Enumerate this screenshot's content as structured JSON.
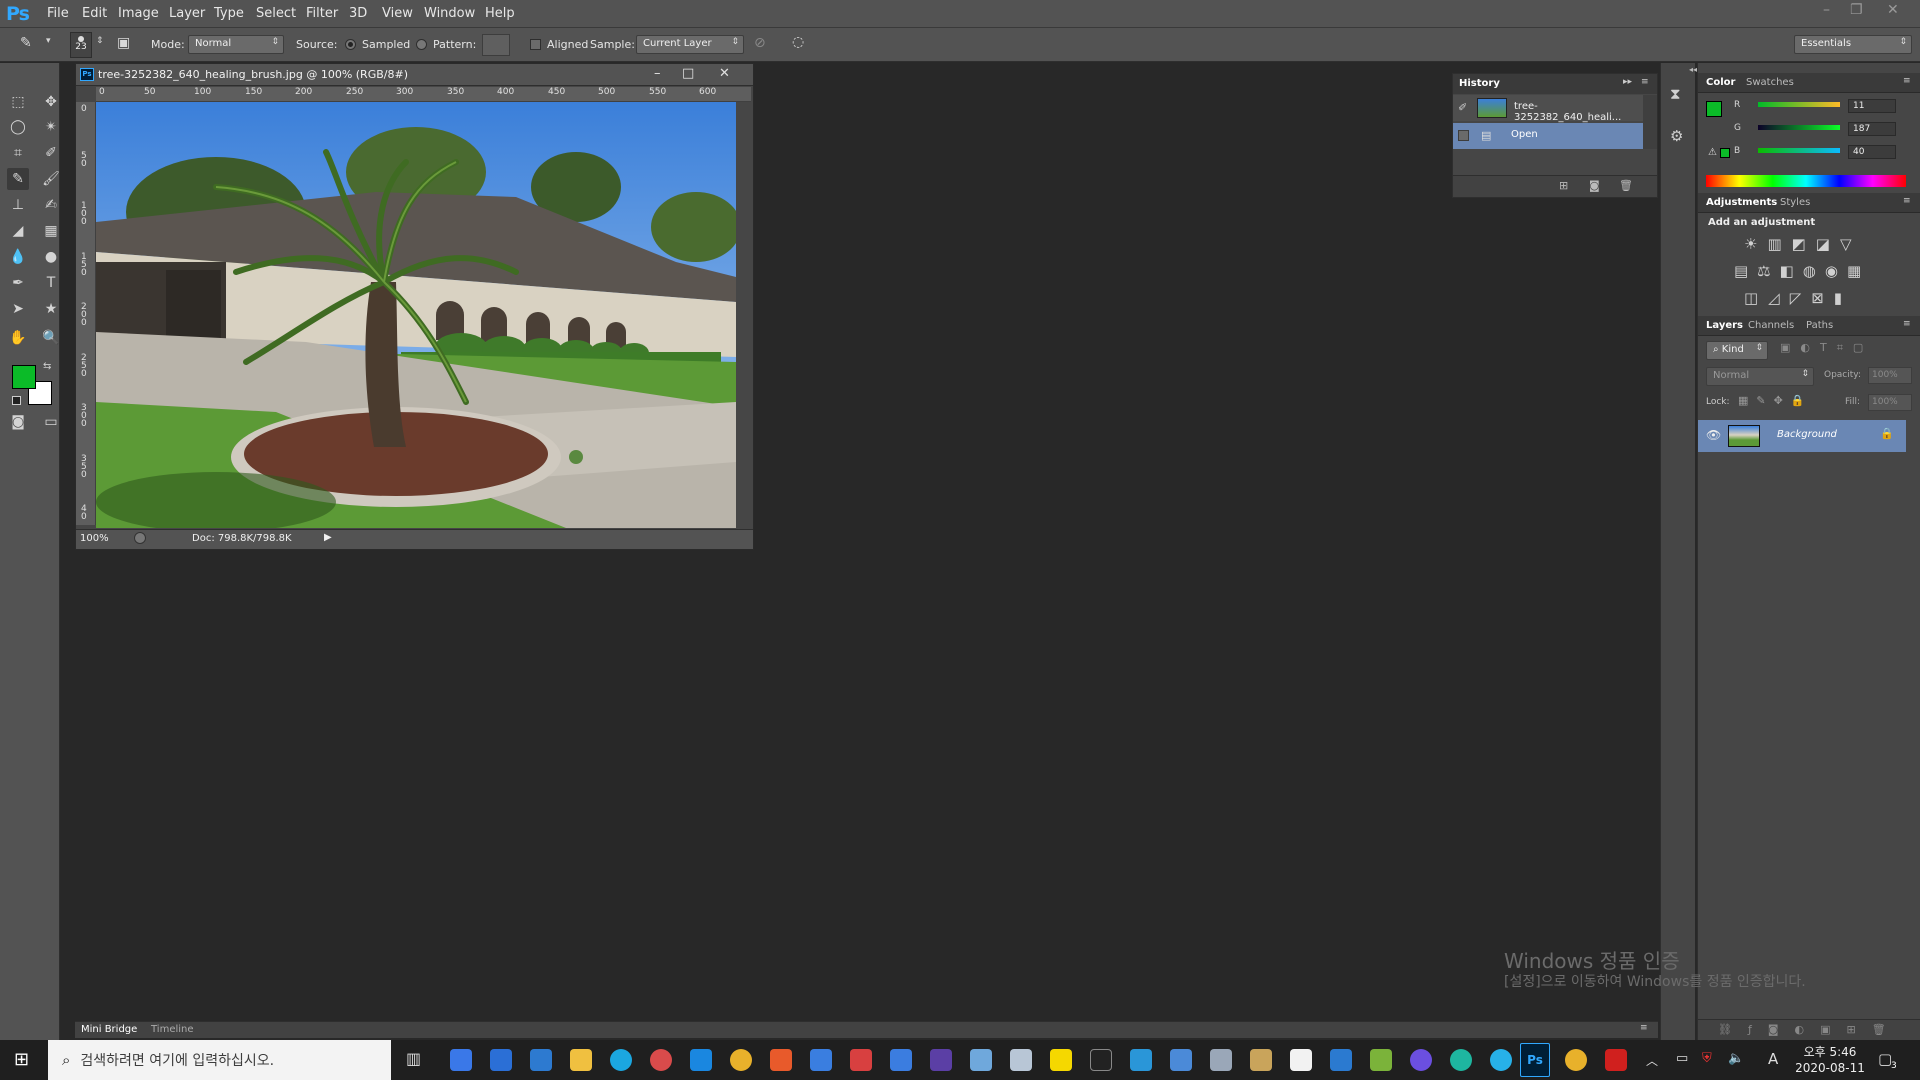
{
  "app": {
    "logo": "Ps",
    "menu": [
      "File",
      "Edit",
      "Image",
      "Layer",
      "Type",
      "Select",
      "Filter",
      "3D",
      "View",
      "Window",
      "Help"
    ]
  },
  "options": {
    "brush_size": "23",
    "mode_label": "Mode:",
    "mode_value": "Normal",
    "source_label": "Source:",
    "sampled_label": "Sampled",
    "pattern_label": "Pattern:",
    "aligned_label": "Aligned",
    "sample_label": "Sample:",
    "sample_value": "Current Layer",
    "workspace": "Essentials"
  },
  "document": {
    "title": "tree-3252382_640_healing_brush.jpg @ 100% (RGB/8#)",
    "ruler_h": [
      "0",
      "50",
      "100",
      "150",
      "200",
      "250",
      "300",
      "350",
      "400",
      "450",
      "500",
      "550",
      "600"
    ],
    "ruler_v": [
      "0",
      "5 0",
      "1 0 0",
      "1 5 0",
      "2 0 0",
      "2 5 0",
      "3 0 0",
      "3 5 0",
      "4 0"
    ],
    "zoom": "100%",
    "doc_size": "Doc: 798.8K/798.8K"
  },
  "history": {
    "tab": "History",
    "snapshot_name": "tree-3252382_640_heali...",
    "step": "Open"
  },
  "color_panel": {
    "tabs": [
      "Color",
      "Swatches"
    ],
    "r_label": "R",
    "g_label": "G",
    "b_label": "B",
    "r": "11",
    "g": "187",
    "b": "40",
    "fg": "#0bbb28"
  },
  "adjustments": {
    "tabs": [
      "Adjustments",
      "Styles"
    ],
    "heading": "Add an adjustment"
  },
  "layers": {
    "tabs": [
      "Layers",
      "Channels",
      "Paths"
    ],
    "kind": "Kind",
    "blend": "Normal",
    "opacity_label": "Opacity:",
    "opacity_value": "100%",
    "lock_label": "Lock:",
    "fill_label": "Fill:",
    "fill_value": "100%",
    "layer_name": "Background"
  },
  "bottom_tabs": [
    "Mini Bridge",
    "Timeline"
  ],
  "watermark": {
    "line1": "Windows 정품 인증",
    "line2": "[설정]으로 이동하여 Windows를 정품 인증합니다."
  },
  "taskbar": {
    "search_placeholder": "검색하려면 여기에 입력하십시오.",
    "time": "오후 5:46",
    "date": "2020-08-11",
    "notification_count": "3",
    "ime": "A"
  }
}
